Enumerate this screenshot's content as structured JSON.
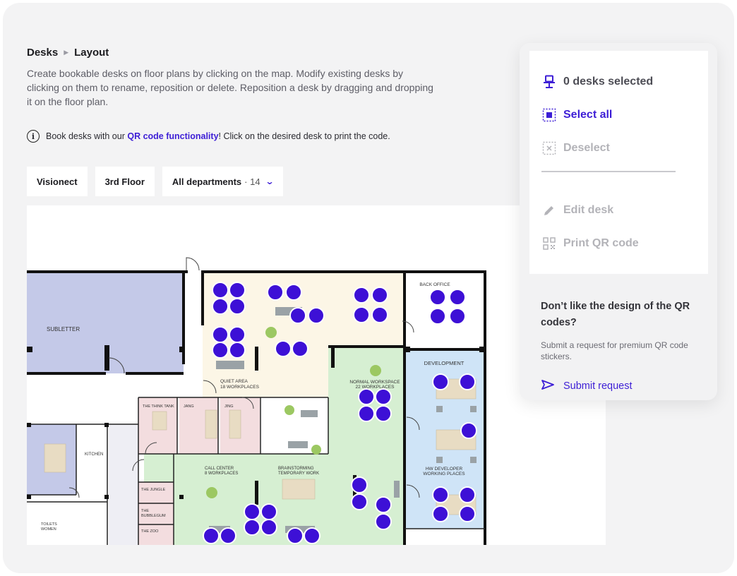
{
  "breadcrumb": {
    "section": "Desks",
    "page": "Layout"
  },
  "description": "Create bookable desks on floor plans by clicking on the map. Modify existing desks by clicking on them to rename, reposition or delete. Reposition a desk by dragging and dropping it on the floor plan.",
  "info": {
    "prefix": "Book desks with our ",
    "link": "QR code functionality",
    "suffix": "! Click on the desired desk to print the code."
  },
  "filters": {
    "organization": "Visionect",
    "floor": "3rd Floor",
    "department": "All departments",
    "department_count": "· 14"
  },
  "panel": {
    "selected_label": "0 desks selected",
    "select_all": "Select all",
    "deselect": "Deselect",
    "edit_desk": "Edit desk",
    "print_qr": "Print QR code",
    "qr_title": "Don’t like the design of the QR codes?",
    "qr_text": "Submit a request for premium QR code stickers.",
    "submit": "Submit request"
  },
  "map": {
    "rooms": {
      "subletter": "SUBLETTER",
      "quiet_area": "QUIET AREA",
      "quiet_area_sub": "18 WORKPLACES",
      "back_office": "BACK OFFICE",
      "development": "DEVELOPMENT",
      "normal_workspace": "NORMAL WORKSPACE",
      "normal_workspace_sub": "22 WORKPLACES",
      "think_tank": "THE THINK TANK",
      "jang": "JANG",
      "jing": "JING",
      "kitchen": "KITCHEN",
      "call_center": "CALL CENTER",
      "call_center_sub": "8 WORKPLACES",
      "brainstorming": "BRAINSTORMING",
      "brainstorming_sub": "TEMPORARY WORK",
      "hw_developer": "HW DEVELOPER",
      "hw_developer_sub": "WORKING PLACES",
      "jungle": "THE JUNGLE",
      "bubblegum_1": "THE",
      "bubblegum_2": "BUBBLEGUM",
      "zoo": "THE ZOO",
      "toilets": "TOILETS",
      "toilets_sub": "WOMEN"
    }
  },
  "colors": {
    "accent": "#3d1ed6",
    "desk": "#3d10d6",
    "subletter_fill": "#c4c9e8",
    "quiet_fill": "#fcf6e6",
    "workspace_fill": "#d6efd2",
    "development_fill": "#cfe4f7",
    "meeting_fill": "#f3dddf"
  }
}
